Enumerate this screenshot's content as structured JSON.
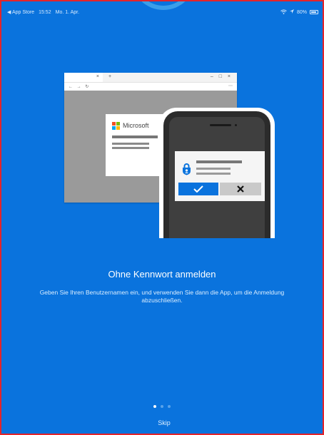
{
  "status_bar": {
    "back_app": "◀ App Store",
    "time": "15:52",
    "date": "Mo. 1. Apr.",
    "battery": "80%"
  },
  "illustration": {
    "brand_name": "Microsoft",
    "browser_tab_close": "×",
    "browser_new_tab": "+",
    "browser_controls": "– □ ×",
    "browser_nav": "← → ↻",
    "browser_menu": "⋯"
  },
  "main": {
    "title": "Ohne Kennwort anmelden",
    "subtitle": "Geben Sie Ihren Benutzernamen ein, und verwenden Sie dann die App, um die Anmeldung abzuschließen."
  },
  "pager": {
    "total": 3,
    "current": 1
  },
  "footer": {
    "skip_label": "Skip"
  },
  "colors": {
    "background": "#0a73dd",
    "border": "#e3242b",
    "approve": "#0a73dd",
    "deny": "#c9c9c9"
  }
}
